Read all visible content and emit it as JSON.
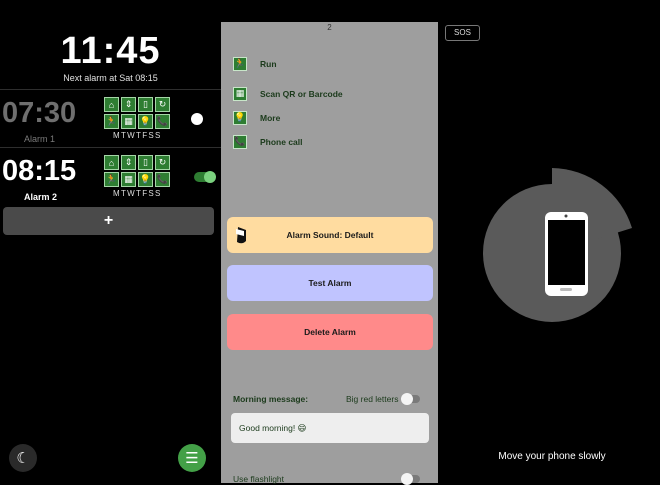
{
  "clock": {
    "time": "11:45",
    "next_alarm": "Next alarm at Sat 08:15"
  },
  "alarms": [
    {
      "time": "07:30",
      "label": "Alarm 1",
      "days": "MTWTFSS",
      "enabled": false,
      "tasks": [
        "door-icon",
        "arrows-icon",
        "phone-outline-icon",
        "refresh-icon",
        "run-icon",
        "qr-icon",
        "bulb-icon",
        "phone-call-icon"
      ]
    },
    {
      "time": "08:15",
      "label": "Alarm 2",
      "days": "MTWTFSS",
      "enabled": true,
      "tasks": [
        "door-icon",
        "arrows-icon",
        "phone-outline-icon",
        "refresh-icon",
        "run-icon",
        "qr-icon",
        "bulb-icon",
        "phone-call-icon"
      ]
    }
  ],
  "add_button": "+",
  "panel": {
    "page_number": "2",
    "menu": [
      {
        "label": "Run",
        "icon": "run-icon"
      },
      {
        "label": "Scan QR or Barcode",
        "icon": "qr-icon"
      },
      {
        "label": "More",
        "icon": "bulb-icon"
      },
      {
        "label": "Phone call",
        "icon": "phone-call-icon"
      }
    ],
    "sound_button": "Alarm Sound: Default",
    "test_button": "Test Alarm",
    "delete_button": "Delete Alarm",
    "morning_message_label": "Morning message:",
    "big_red_letters_label": "Big red letters",
    "morning_message_value": "Good morning! 😄",
    "flashlight_label": "Use flashlight"
  },
  "sos_label": "SOS",
  "move_message": "Move your phone slowly",
  "colors": {
    "accent": "#2e7d32",
    "sound": "#ffdca0",
    "test": "#c0c4ff",
    "delete": "#ff8a8a",
    "panel": "#9e9e9e"
  }
}
